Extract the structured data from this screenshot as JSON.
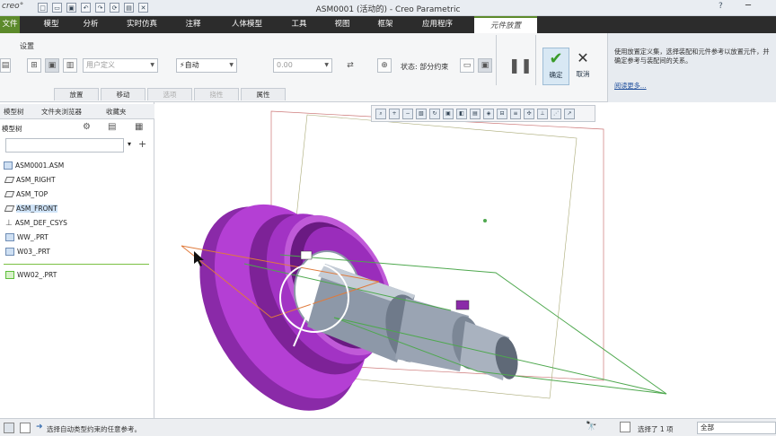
{
  "app": {
    "logo": "creo°",
    "window_title": "ASM0001 (活动的) - Creo Parametric",
    "help_icon": "?",
    "minimize_icon": "─"
  },
  "menu": {
    "file": "文件",
    "tabs": [
      "模型",
      "分析",
      "实时仿真",
      "注释",
      "人体模型",
      "工具",
      "视图",
      "框架",
      "应用程序"
    ],
    "active_tab": "元件放置"
  },
  "ribbon": {
    "settings_label": "设置",
    "constraint_type": "用户定义",
    "auto_label": "⚡自动",
    "offset_value": "0.00",
    "status_label": "状态: 部分约束",
    "subtabs": [
      "放置",
      "移动",
      "选项",
      "挠性",
      "属性"
    ],
    "ok_label": "确定",
    "cancel_label": "取消"
  },
  "help": {
    "text": "使用放置定义集，选择装配和元件参考以放置元件，并确定参考与装配间的关系。",
    "more_link": "阅读更多..."
  },
  "left_panel": {
    "tabs": [
      "模型树",
      "文件夹浏览器",
      "收藏夹"
    ],
    "tree_label": "模型树",
    "items": [
      {
        "label": "ASM0001.ASM",
        "type": "asm"
      },
      {
        "label": "ASM_RIGHT",
        "type": "plane"
      },
      {
        "label": "ASM_TOP",
        "type": "plane"
      },
      {
        "label": "ASM_FRONT",
        "type": "plane"
      },
      {
        "label": "ASM_DEF_CSYS",
        "type": "csys"
      },
      {
        "label": "WW_.PRT",
        "type": "part"
      },
      {
        "label": "W03_.PRT",
        "type": "part"
      },
      {
        "label": "WW02_.PRT",
        "type": "part"
      }
    ]
  },
  "statusbar": {
    "message": "选择自动类型约束的任意参考。",
    "selected": "选择了 1 项",
    "filter": "全部"
  },
  "colors": {
    "accent": "#5c8a2b",
    "part_magenta": "#a233c4",
    "shaft_gray": "#8d98a8",
    "constraint_green": "#4ea84e"
  }
}
